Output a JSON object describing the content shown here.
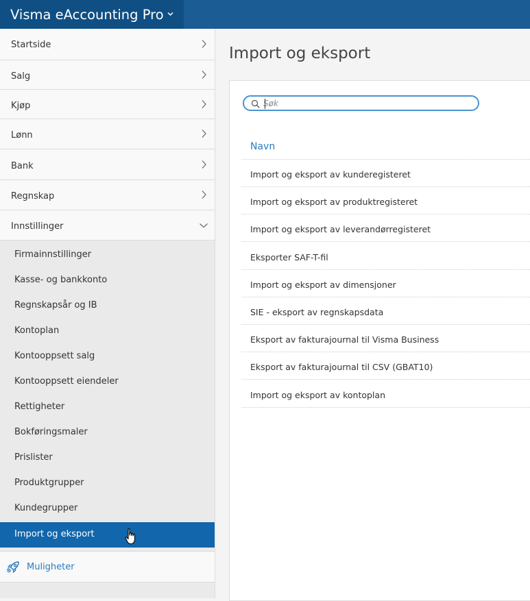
{
  "app": {
    "title": "Visma eAccounting Pro"
  },
  "sidebar": {
    "items": [
      {
        "label": "Startside"
      },
      {
        "label": "Salg"
      },
      {
        "label": "Kjøp"
      },
      {
        "label": "Lønn"
      },
      {
        "label": "Bank"
      },
      {
        "label": "Regnskap"
      },
      {
        "label": "Innstillinger"
      }
    ],
    "subitems": [
      {
        "label": "Firmainnstillinger"
      },
      {
        "label": "Kasse- og bankkonto"
      },
      {
        "label": "Regnskapsår og IB"
      },
      {
        "label": "Kontoplan"
      },
      {
        "label": "Kontooppsett salg"
      },
      {
        "label": "Kontooppsett eiendeler"
      },
      {
        "label": "Rettigheter"
      },
      {
        "label": "Bokføringsmaler"
      },
      {
        "label": "Prislister"
      },
      {
        "label": "Produktgrupper"
      },
      {
        "label": "Kundegrupper"
      },
      {
        "label": "Import og eksport"
      }
    ],
    "active_subitem": "Import og eksport",
    "muligheter": "Muligheter"
  },
  "main": {
    "title": "Import og eksport",
    "search": {
      "placeholder": "Søk",
      "value": ""
    },
    "table": {
      "column": "Navn",
      "rows": [
        "Import og eksport av kunderegisteret",
        "Import og eksport av produktregisteret",
        "Import og eksport av leverandørregisteret",
        "Eksporter SAF-T-fil",
        "Import og eksport av dimensjoner",
        "SIE - eksport av regnskapsdata",
        "Eksport av fakturajournal til Visma Business",
        "Eksport av fakturajournal til CSV (GBAT10)",
        "Import og eksport av kontoplan"
      ]
    }
  },
  "colors": {
    "topbar": "#1a5c93",
    "topbar_dark": "#0f4f84",
    "active": "#1266ab",
    "link": "#2b7bc0"
  },
  "icons": {
    "app_switch": "chevron-down-icon",
    "nav": "chevron-right-icon",
    "nav_open": "chevron-down-icon",
    "search": "search-icon",
    "muligheter": "rocket-icon",
    "cursor": "hand-pointer-icon"
  }
}
